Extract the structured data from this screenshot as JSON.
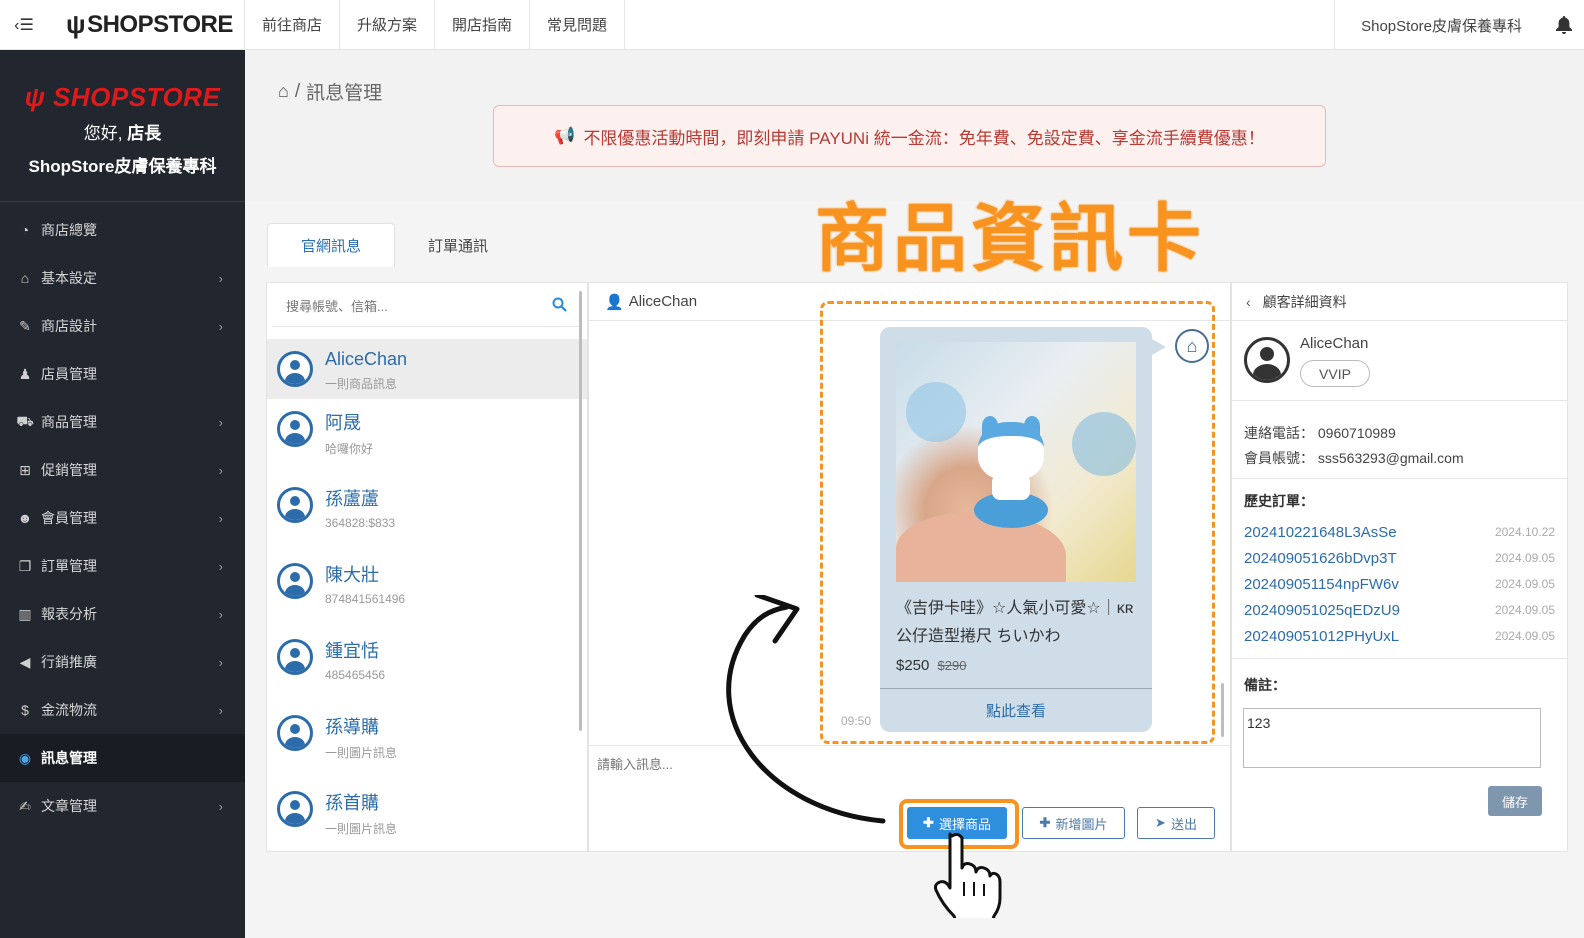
{
  "topbar": {
    "menu_toggle": "‹☰",
    "logo": "SHOPSTORE",
    "nav": [
      "前往商店",
      "升級方案",
      "開店指南",
      "常見問題"
    ],
    "store_name": "ShopStore皮膚保養專科"
  },
  "sidebar": {
    "logo": "SHOPSTORE",
    "greeting_prefix": "您好,",
    "greeting_role": "店長",
    "store_name": "ShopStore皮膚保養專科",
    "items": [
      {
        "label": "商店總覽",
        "icon": "dashboard-icon",
        "glyph": "◔",
        "has_sub": false
      },
      {
        "label": "基本設定",
        "icon": "bank-icon",
        "glyph": "⌂",
        "has_sub": true
      },
      {
        "label": "商店設計",
        "icon": "wand-icon",
        "glyph": "✎",
        "has_sub": true
      },
      {
        "label": "店員管理",
        "icon": "user-secret-icon",
        "glyph": "♟",
        "has_sub": false
      },
      {
        "label": "商品管理",
        "icon": "cart-icon",
        "glyph": "⛟",
        "has_sub": true
      },
      {
        "label": "促銷管理",
        "icon": "gift-icon",
        "glyph": "⊞",
        "has_sub": true
      },
      {
        "label": "會員管理",
        "icon": "users-icon",
        "glyph": "☻",
        "has_sub": true
      },
      {
        "label": "訂單管理",
        "icon": "copy-icon",
        "glyph": "❐",
        "has_sub": true
      },
      {
        "label": "報表分析",
        "icon": "bar-chart-icon",
        "glyph": "▥",
        "has_sub": true
      },
      {
        "label": "行銷推廣",
        "icon": "bullhorn-icon",
        "glyph": "◀",
        "has_sub": true
      },
      {
        "label": "金流物流",
        "icon": "dollar-icon",
        "glyph": "$",
        "has_sub": true
      },
      {
        "label": "訊息管理",
        "icon": "comments-icon",
        "glyph": "◉",
        "has_sub": false,
        "active": true
      },
      {
        "label": "文章管理",
        "icon": "edit-icon",
        "glyph": "✍",
        "has_sub": true
      }
    ]
  },
  "breadcrumb": {
    "separator": "/",
    "current": "訊息管理"
  },
  "promo": {
    "text": "不限優惠活動時間，即刻申請 PAYUNi 統一金流：免年費、免設定費、享金流手續費優惠！"
  },
  "annotation": {
    "title": "商品資訊卡"
  },
  "tabs": [
    {
      "label": "官網訊息",
      "active": true
    },
    {
      "label": "訂單通訊",
      "active": false
    }
  ],
  "user_list": {
    "search_placeholder": "搜尋帳號、信箱...",
    "users": [
      {
        "name": "AliceChan",
        "preview": "一則商品訊息",
        "selected": true
      },
      {
        "name": "阿晟",
        "preview": "哈囉你好"
      },
      {
        "name": "孫蘆蘆",
        "preview": "364828:$833"
      },
      {
        "name": "陳大壯",
        "preview": "874841561496"
      },
      {
        "name": "鍾宜恬",
        "preview": "485465456"
      },
      {
        "name": "孫導購",
        "preview": "一則圖片訊息"
      },
      {
        "name": "孫首購",
        "preview": "一則圖片訊息"
      }
    ]
  },
  "chat": {
    "contact": "AliceChan",
    "product_card": {
      "title": "《吉伊卡哇》☆人氣小可愛☆｜ᴋʀ公仔造型捲尺 ちいかわ",
      "price": "$250",
      "original_price": "$290",
      "link_label": "點此查看",
      "time": "09:50"
    },
    "input_placeholder": "請輸入訊息...",
    "buttons": {
      "select_product": "選擇商品",
      "add_image": "新增圖片",
      "send": "送出"
    }
  },
  "detail": {
    "header": "顧客詳細資料",
    "name": "AliceChan",
    "level": "VVIP",
    "phone_label": "連絡電話：",
    "phone": "0960710989",
    "account_label": "會員帳號：",
    "account": "sss563293@gmail.com",
    "orders_title": "歷史訂單：",
    "orders": [
      {
        "id": "202410221648L3AsSe",
        "date": "2024.10.22"
      },
      {
        "id": "202409051626bDvp3T",
        "date": "2024.09.05"
      },
      {
        "id": "202409051154npFW6v",
        "date": "2024.09.05"
      },
      {
        "id": "202409051025qEDzU9",
        "date": "2024.09.05"
      },
      {
        "id": "202409051012PHyUxL",
        "date": "2024.09.05"
      }
    ],
    "note_title": "備註：",
    "note_value": "123",
    "save_label": "儲存"
  },
  "colors": {
    "sidebar_bg": "#22262e",
    "accent_blue": "#2d8fde",
    "link_blue": "#2c6cab",
    "highlight_orange": "#f7931e",
    "brand_red": "#e0191c",
    "promo_text": "#b83a33"
  }
}
